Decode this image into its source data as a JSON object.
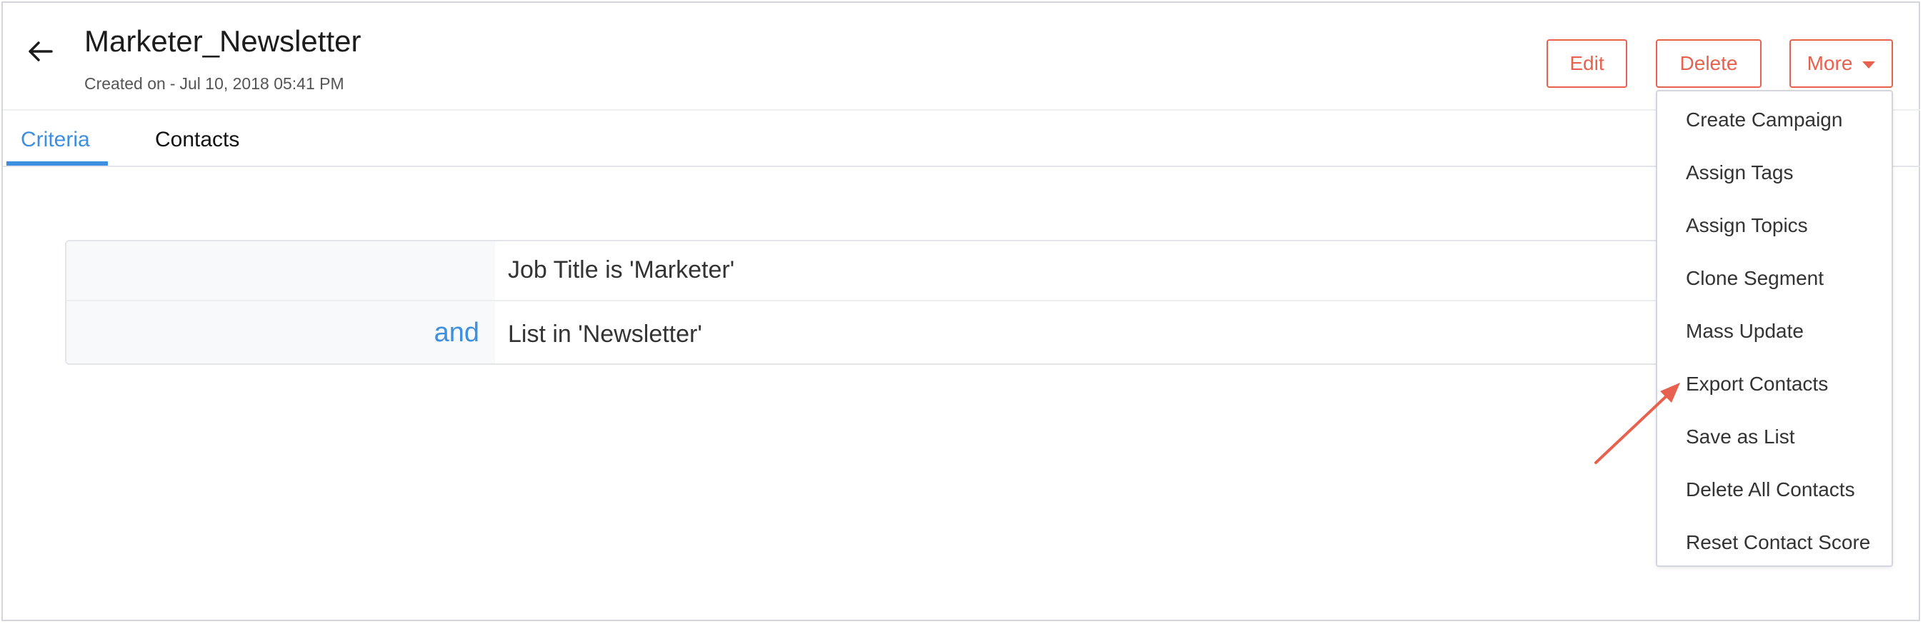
{
  "header": {
    "title": "Marketer_Newsletter",
    "created_label": "Created on",
    "created_date": "Jul 10, 2018 05:41 PM"
  },
  "actions": {
    "edit_label": "Edit",
    "delete_label": "Delete",
    "more_label": "More"
  },
  "tabs": [
    {
      "label": "Criteria",
      "active": true
    },
    {
      "label": "Contacts",
      "active": false
    }
  ],
  "criteria": {
    "rows": [
      {
        "operator": "",
        "text": "Job Title is 'Marketer'"
      },
      {
        "operator": "and",
        "text": "List in 'Newsletter'"
      }
    ]
  },
  "more_menu": {
    "items": [
      "Create Campaign",
      "Assign Tags",
      "Assign Topics",
      "Clone Segment",
      "Mass Update",
      "Export Contacts",
      "Save as List",
      "Delete All Contacts",
      "Reset Contact Score"
    ]
  },
  "icons": {
    "back": "arrow-left-icon",
    "more_caret": "caret-down-icon",
    "annotation": "annotation-arrow-icon"
  },
  "colors": {
    "accent": "#e8614e",
    "active_tab": "#3d8fe0",
    "operator": "#3d8fe0"
  }
}
